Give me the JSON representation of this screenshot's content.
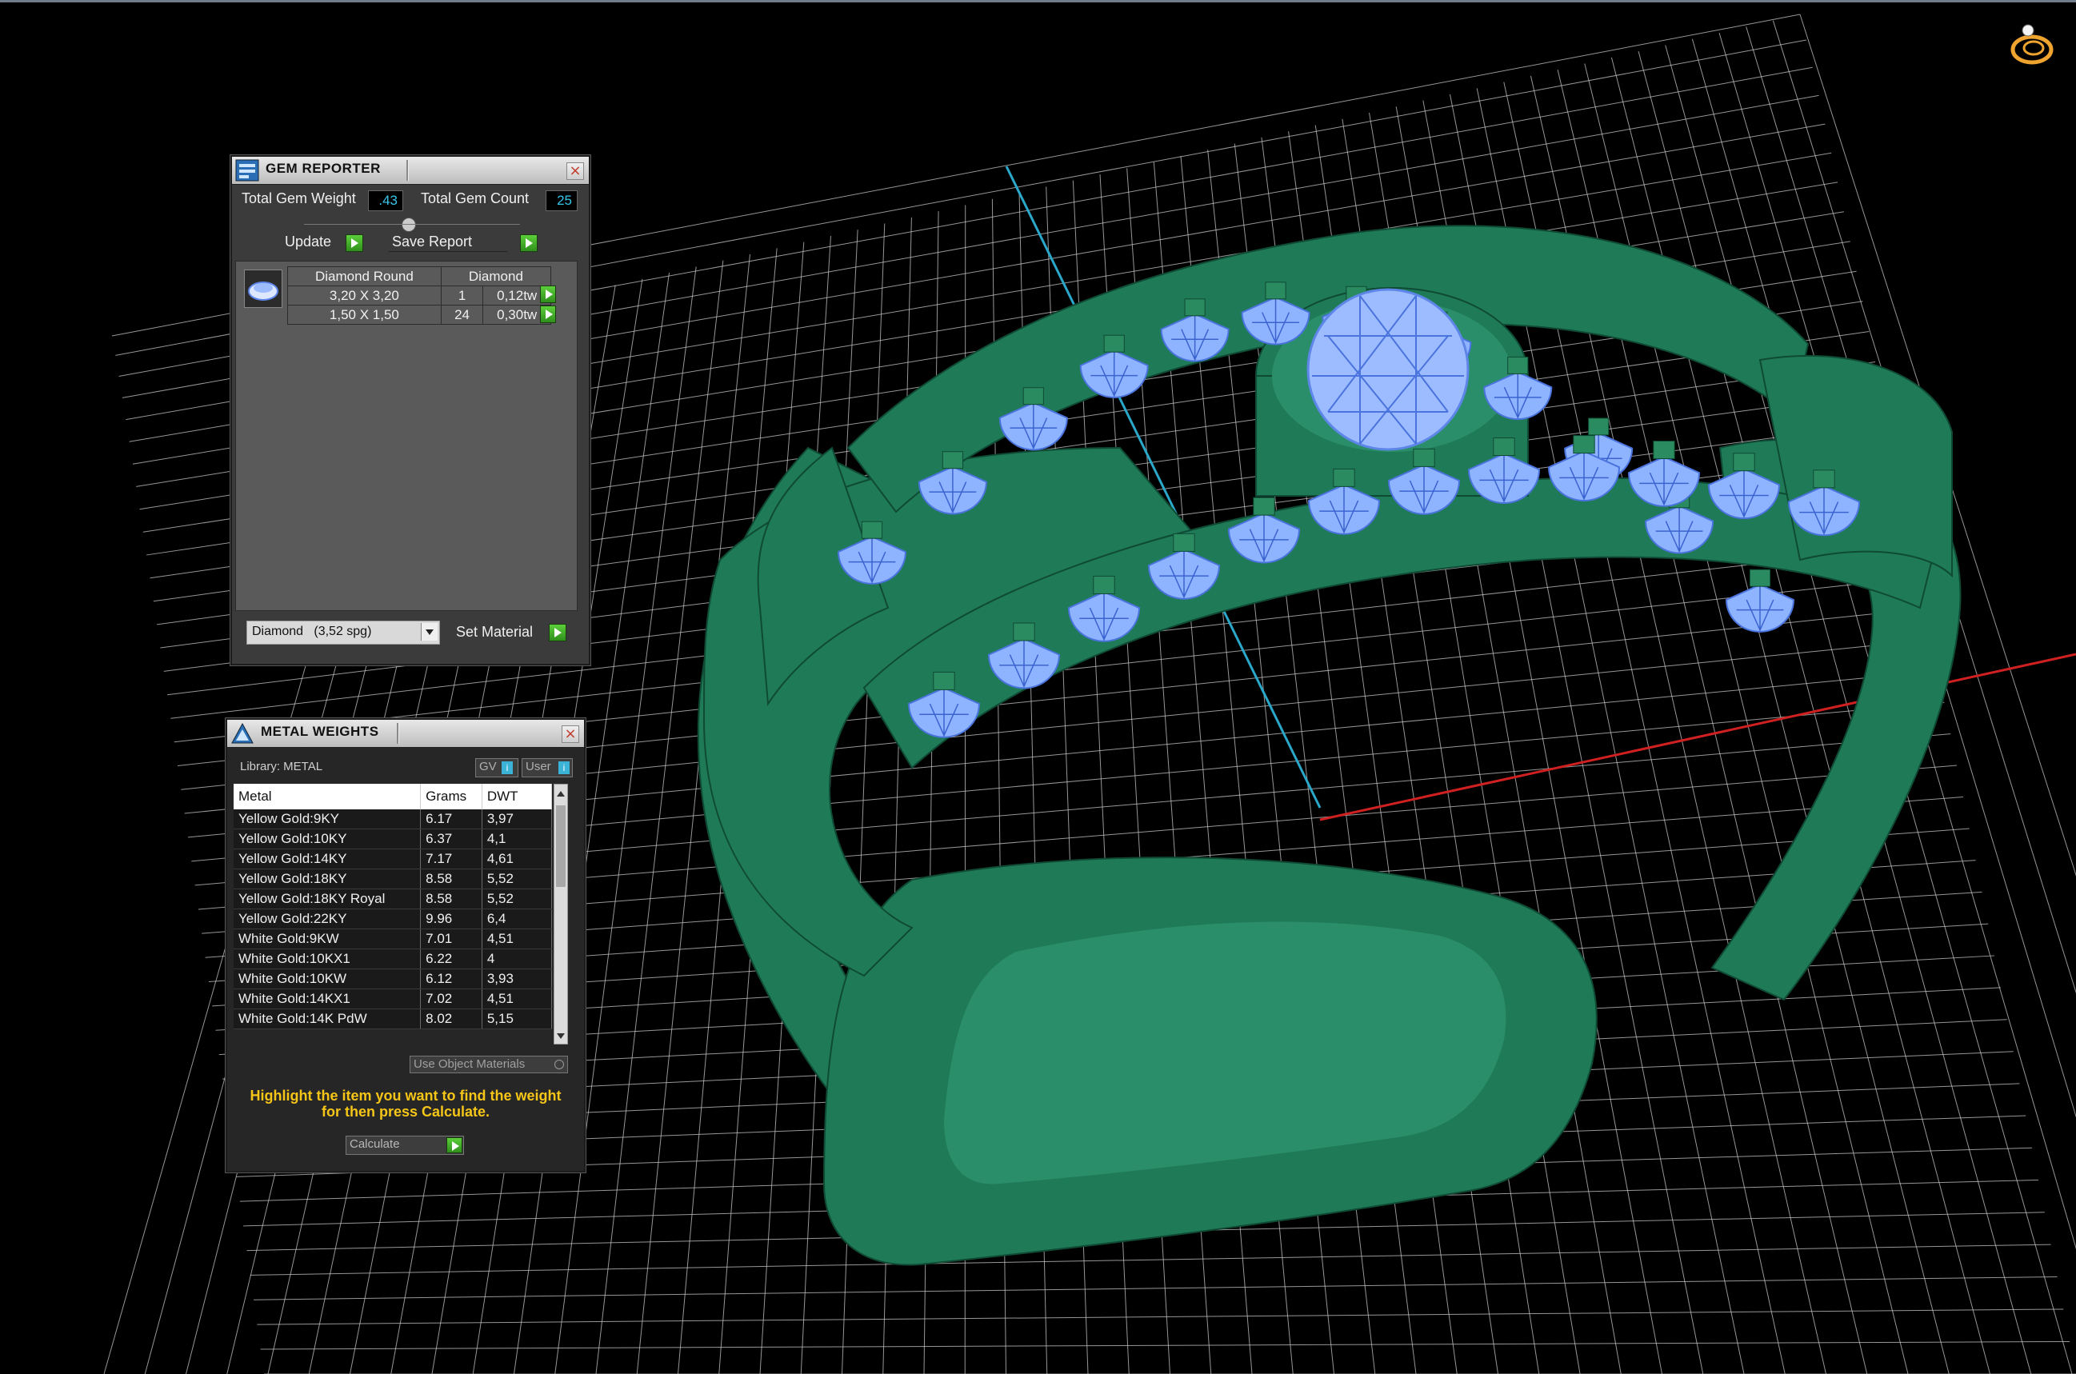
{
  "colors": {
    "grid": "#c8c8c8",
    "axis_x": "#d02020",
    "axis_y": "#2aa7c9",
    "wax": "#1f7a58",
    "gem": "#8fb4ff",
    "value_text": "#37c6ea",
    "hint_text": "#f5c518",
    "green_button": "#3fae24"
  },
  "viewport": {
    "view_cube_icon": "ring-orientation-icon"
  },
  "gem_reporter": {
    "title": "GEM REPORTER",
    "total_weight_label": "Total Gem Weight",
    "total_weight_value": ".43",
    "total_count_label": "Total Gem Count",
    "total_count_value": "25",
    "update_label": "Update",
    "save_report_label": "Save Report",
    "table_header_shape": "Diamond Round",
    "table_header_material": "Diamond",
    "rows": [
      {
        "size": "3,20 X 3,20",
        "count": "1",
        "weight": "0,12tw"
      },
      {
        "size": "1,50 X 1,50",
        "count": "24",
        "weight": "0,30tw"
      }
    ],
    "material_select": "Diamond   (3,52 spg)",
    "set_material_label": "Set Material"
  },
  "metal_weights": {
    "title": "METAL WEIGHTS",
    "library_label": "Library: METAL",
    "gv_label": "GV",
    "user_label": "User",
    "columns": [
      "Metal",
      "Grams",
      "DWT"
    ],
    "rows": [
      [
        "Yellow Gold:9KY",
        "6.17",
        "3,97"
      ],
      [
        "Yellow Gold:10KY",
        "6.37",
        "4,1"
      ],
      [
        "Yellow Gold:14KY",
        "7.17",
        "4,61"
      ],
      [
        "Yellow Gold:18KY",
        "8.58",
        "5,52"
      ],
      [
        "Yellow Gold:18KY Royal",
        "8.58",
        "5,52"
      ],
      [
        "Yellow Gold:22KY",
        "9.96",
        "6,4"
      ],
      [
        "White Gold:9KW",
        "7.01",
        "4,51"
      ],
      [
        "White Gold:10KX1",
        "6.22",
        "4"
      ],
      [
        "White Gold:10KW",
        "6.12",
        "3,93"
      ],
      [
        "White Gold:14KX1",
        "7.02",
        "4,51"
      ],
      [
        "White Gold:14K PdW",
        "8.02",
        "5,15"
      ]
    ],
    "use_object_materials_label": "Use Object Materials",
    "hint_line1": "Highlight the item you want to find the weight",
    "hint_line2": "for then press Calculate.",
    "calculate_label": "Calculate"
  }
}
